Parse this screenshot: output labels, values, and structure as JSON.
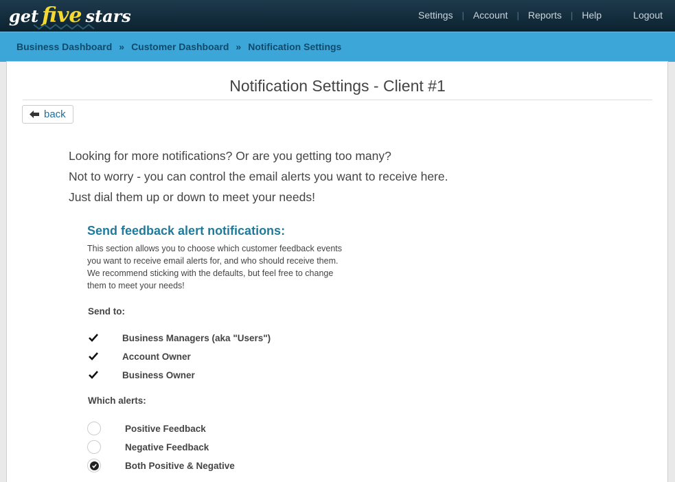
{
  "brand": {
    "part1": "get",
    "part2": "five",
    "part3": "stars"
  },
  "nav": {
    "settings": "Settings",
    "account": "Account",
    "reports": "Reports",
    "help": "Help",
    "logout": "Logout",
    "separator": "|"
  },
  "breadcrumb": {
    "items": [
      "Business Dashboard",
      "Customer Dashboard",
      "Notification Settings"
    ],
    "separator": "»"
  },
  "page": {
    "title": "Notification Settings - Client #1",
    "back_label": "back",
    "intro": [
      "Looking for more notifications? Or are you getting too many?",
      "Not to worry - you can control the email alerts you want to receive here.",
      "Just dial them up or down to meet your needs!"
    ]
  },
  "feedback_section": {
    "title": "Send feedback alert notifications:",
    "description": [
      "This section allows you to choose which customer feedback events",
      "you want to receive email alerts for, and who should receive them.",
      "We recommend sticking with the defaults, but feel free to change",
      "them to meet your needs!"
    ],
    "send_to_label": "Send to:",
    "recipients": [
      {
        "label": "Business Managers (aka \"Users\")",
        "checked": true
      },
      {
        "label": "Account Owner",
        "checked": true
      },
      {
        "label": "Business Owner",
        "checked": true
      }
    ],
    "which_alerts_label": "Which alerts:",
    "alerts": [
      {
        "label": "Positive Feedback",
        "selected": false
      },
      {
        "label": "Negative Feedback",
        "selected": false
      },
      {
        "label": "Both Positive & Negative",
        "selected": true
      }
    ]
  },
  "colors": {
    "topbar": "#0c2230",
    "crumbbar": "#3da6d9",
    "accent": "#1f7a9c",
    "logo_highlight": "#f5d931"
  }
}
